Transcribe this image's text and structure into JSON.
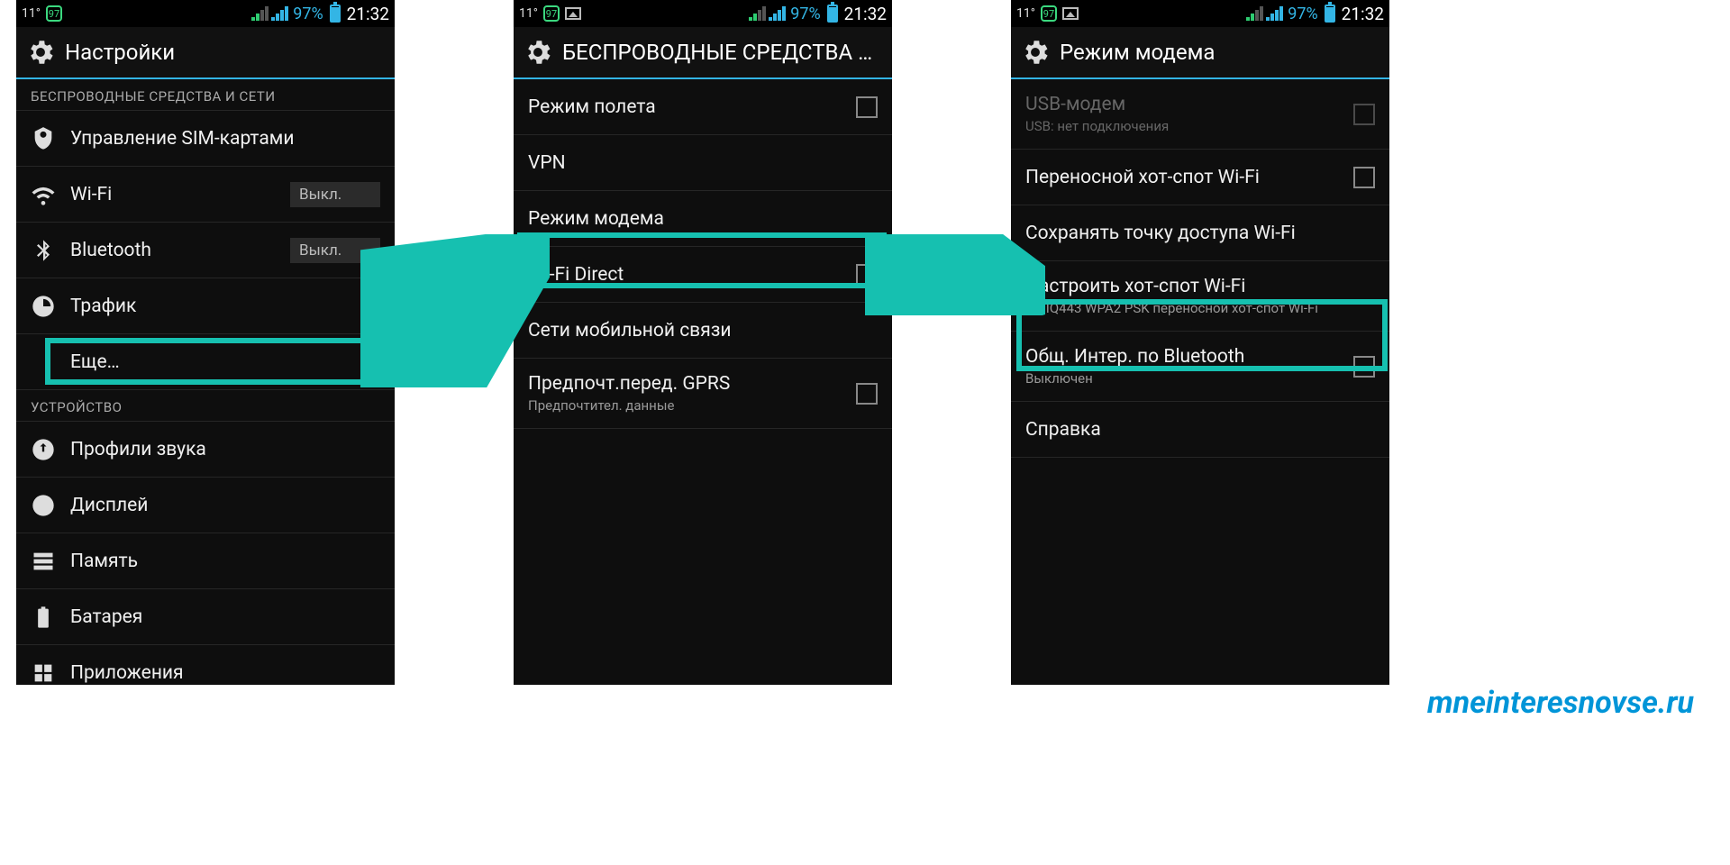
{
  "statusbar": {
    "temp": "11°",
    "badge": "97",
    "battery_pct": "97%",
    "time": "21:32"
  },
  "panel1": {
    "title": "Настройки",
    "section_wireless": "БЕСПРОВОДНЫЕ СРЕДСТВА И СЕТИ",
    "sim": "Управление SIM-картами",
    "wifi": "Wi-Fi",
    "wifi_state": "Выкл.",
    "bluetooth": "Bluetooth",
    "bt_state": "Выкл.",
    "traffic": "Трафик",
    "more": "Еще…",
    "section_device": "УСТРОЙСТВО",
    "sound": "Профили звука",
    "display": "Дисплей",
    "memory": "Память",
    "battery": "Батарея",
    "apps": "Приложения"
  },
  "panel2": {
    "title": "БЕСПРОВОДНЫЕ СРЕДСТВА И СЕ…",
    "airplane": "Режим полета",
    "vpn": "VPN",
    "tether": "Режим модема",
    "wifidirect": "Wi-Fi Direct",
    "mobile": "Сети мобильной связи",
    "gprs": "Предпочт.перед. GPRS",
    "gprs_sub": "Предпочтител. данные"
  },
  "panel3": {
    "title": "Режим модема",
    "usb": "USB-модем",
    "usb_sub": "USB: нет подключения",
    "hotspot": "Переносной хот-спот Wi-Fi",
    "keep": "Сохранять точку доступа Wi-Fi",
    "configure": "Настроить хот-спот Wi-Fi",
    "configure_sub": "Fly IQ443 WPA2 PSK переносной хот-спот Wi-Fi",
    "bt": "Общ. Интер. по Bluetooth",
    "bt_sub": "Выключен",
    "help": "Справка"
  },
  "watermark": "mneinteresnovse.ru",
  "colors": {
    "accent": "#33b5e5",
    "hl": "#16c0b0"
  }
}
